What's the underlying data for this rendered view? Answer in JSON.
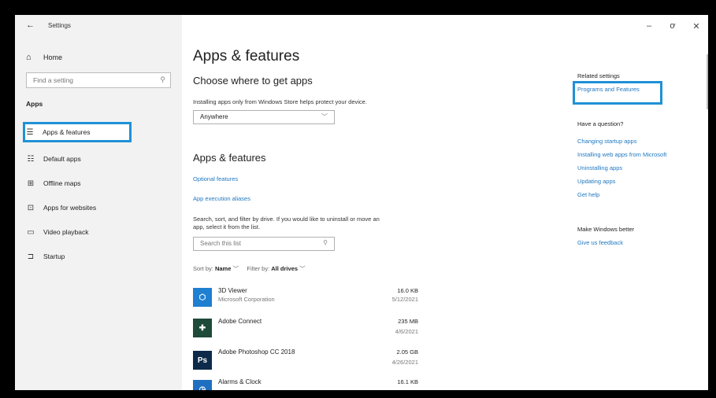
{
  "window": {
    "title": "Settings",
    "back_icon": "←",
    "minimize_icon": "–",
    "maximize_icon": "ơ",
    "close_icon": "✕"
  },
  "sidebar": {
    "home_label": "Home",
    "home_icon": "⌂",
    "search_placeholder": "Find a setting",
    "section_label": "Apps",
    "items": [
      {
        "label": "Apps & features",
        "icon": "☰",
        "active": true
      },
      {
        "label": "Default apps",
        "icon": "☷"
      },
      {
        "label": "Offline maps",
        "icon": "⊞"
      },
      {
        "label": "Apps for websites",
        "icon": "⊡"
      },
      {
        "label": "Video playback",
        "icon": "▭"
      },
      {
        "label": "Startup",
        "icon": "⊐"
      }
    ]
  },
  "main": {
    "page_title": "Apps & features",
    "choose_heading": "Choose where to get apps",
    "choose_desc": "Installing apps only from Windows Store helps protect your device.",
    "source_dropdown": "Anywhere",
    "apps_heading": "Apps & features",
    "optional_features": "Optional features",
    "exec_aliases": "App execution aliases",
    "search_desc_line1": "Search, sort, and filter by drive. If you would like to uninstall or move an",
    "search_desc_line2": "app, select it from the list.",
    "search_list_placeholder": "Search this list",
    "sort_label": "Sort by:",
    "sort_value": "Name",
    "filter_label": "Filter by:",
    "filter_value": "All drives",
    "apps": [
      {
        "name": "3D Viewer",
        "publisher": "Microsoft Corporation",
        "size": "16.0 KB",
        "date": "5/12/2021",
        "color": "#1f7fd1",
        "glyph": "⬡"
      },
      {
        "name": "Adobe Connect",
        "publisher": "",
        "size": "235 MB",
        "date": "4/6/2021",
        "color": "#1e4a3a",
        "glyph": "✚"
      },
      {
        "name": "Adobe Photoshop CC 2018",
        "publisher": "",
        "size": "2.05 GB",
        "date": "4/26/2021",
        "color": "#0d2a4a",
        "glyph": "Ps"
      },
      {
        "name": "Alarms & Clock",
        "publisher": "",
        "size": "16.1 KB",
        "date": "",
        "color": "#1f6fc0",
        "glyph": "◷"
      }
    ]
  },
  "related": {
    "title": "Related settings",
    "programs_link": "Programs and Features",
    "question_heading": "Have a question?",
    "links": [
      "Changing startup apps",
      "Installing web apps from Microsoft",
      "Uninstalling apps",
      "Updating apps",
      "Get help"
    ],
    "improve_heading": "Make Windows better",
    "feedback_link": "Give us feedback"
  },
  "colors": {
    "accent": "#1f91d6",
    "link": "#1f78c1"
  }
}
